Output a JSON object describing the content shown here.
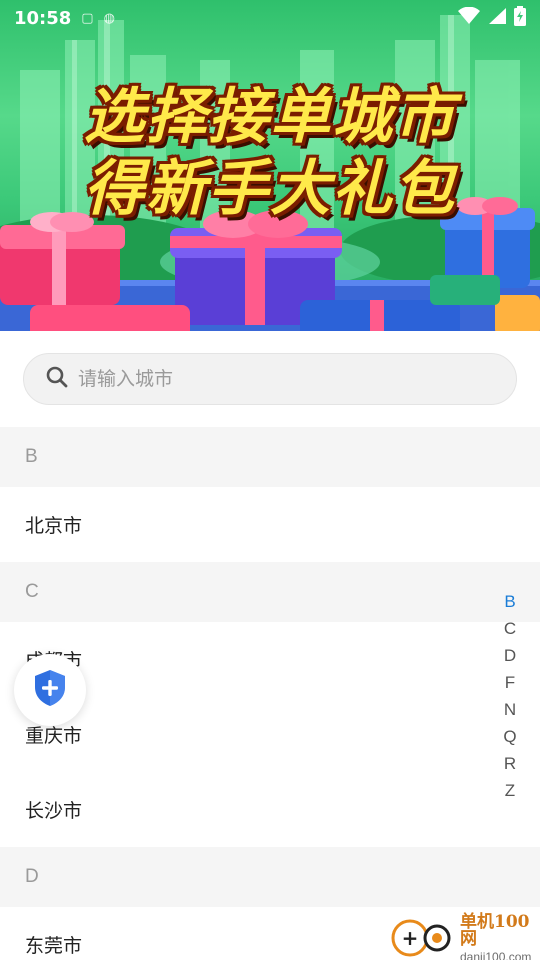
{
  "status_bar": {
    "time": "10:58"
  },
  "banner": {
    "line1": "选择接单城市",
    "line2": "得新手大礼包"
  },
  "search": {
    "placeholder": "请输入城市",
    "value": ""
  },
  "city_sections": [
    {
      "letter": "B",
      "cities": [
        "北京市"
      ]
    },
    {
      "letter": "C",
      "cities": [
        "成都市",
        "重庆市",
        "长沙市"
      ]
    },
    {
      "letter": "D",
      "cities": [
        "东莞市"
      ]
    }
  ],
  "index_bar": {
    "letters": [
      "B",
      "C",
      "D",
      "F",
      "N",
      "Q",
      "R",
      "Z"
    ],
    "active": "B"
  },
  "floating_button": {
    "icon": "shield-plus-icon"
  },
  "watermark": {
    "name": "单机100网",
    "url": "danji100.com",
    "logo_text": "+"
  },
  "colors": {
    "accent": "#1a7cd6",
    "shield": "#2f6fe0",
    "banner_text": "#ffe94a"
  }
}
